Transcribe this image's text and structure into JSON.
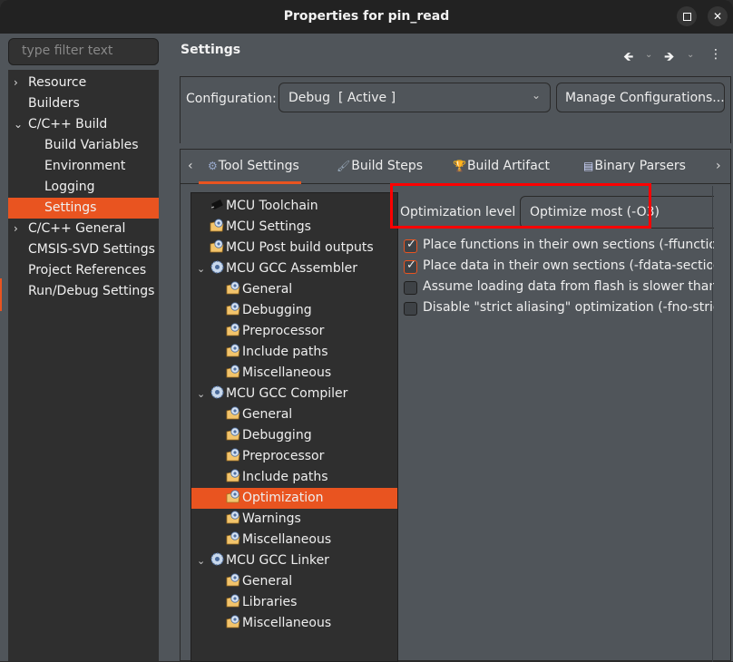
{
  "window": {
    "title": "Properties for pin_read",
    "maximize_icon": "maximize-icon",
    "close_icon": "close-icon"
  },
  "left": {
    "filter_placeholder": "type filter text",
    "nav": [
      {
        "label": "Resource",
        "expander": "collapsed",
        "level": 0
      },
      {
        "label": "Builders",
        "expander": "none",
        "level": 0
      },
      {
        "label": "C/C++ Build",
        "expander": "expanded",
        "level": 0
      },
      {
        "label": "Build Variables",
        "expander": "none",
        "level": 1
      },
      {
        "label": "Environment",
        "expander": "none",
        "level": 1
      },
      {
        "label": "Logging",
        "expander": "none",
        "level": 1
      },
      {
        "label": "Settings",
        "expander": "none",
        "level": 1,
        "selected": true
      },
      {
        "label": "C/C++ General",
        "expander": "collapsed",
        "level": 0
      },
      {
        "label": "CMSIS-SVD Settings",
        "expander": "none",
        "level": 0
      },
      {
        "label": "Project References",
        "expander": "none",
        "level": 0
      },
      {
        "label": "Run/Debug Settings",
        "expander": "none",
        "level": 0
      }
    ]
  },
  "main": {
    "heading": "Settings",
    "nav_icons": [
      "back-arrow-icon",
      "back-history-icon",
      "forward-arrow-icon",
      "forward-history-icon",
      "view-menu-icon"
    ],
    "configuration": {
      "label": "Configuration:",
      "value": "Debug  [ Active ]",
      "manage_button": "Manage Configurations..."
    },
    "tabs": [
      {
        "label": "Tool Settings",
        "icon": "tool-settings-icon",
        "active": true
      },
      {
        "label": "Build Steps",
        "icon": "build-steps-icon"
      },
      {
        "label": "Build Artifact",
        "icon": "build-artifact-icon"
      },
      {
        "label": "Binary Parsers",
        "icon": "binary-parsers-icon"
      }
    ],
    "tool_tree": [
      {
        "label": "MCU Toolchain",
        "icon": "chip",
        "level": 0,
        "expander": "none"
      },
      {
        "label": "MCU Settings",
        "icon": "folder",
        "level": 0,
        "expander": "none"
      },
      {
        "label": "MCU Post build outputs",
        "icon": "folder",
        "level": 0,
        "expander": "none"
      },
      {
        "label": "MCU GCC Assembler",
        "icon": "gear",
        "level": 0,
        "expander": "expanded"
      },
      {
        "label": "General",
        "icon": "folder",
        "level": 1
      },
      {
        "label": "Debugging",
        "icon": "folder",
        "level": 1
      },
      {
        "label": "Preprocessor",
        "icon": "folder",
        "level": 1
      },
      {
        "label": "Include paths",
        "icon": "folder",
        "level": 1
      },
      {
        "label": "Miscellaneous",
        "icon": "folder",
        "level": 1
      },
      {
        "label": "MCU GCC Compiler",
        "icon": "gear",
        "level": 0,
        "expander": "expanded"
      },
      {
        "label": "General",
        "icon": "folder",
        "level": 1
      },
      {
        "label": "Debugging",
        "icon": "folder",
        "level": 1
      },
      {
        "label": "Preprocessor",
        "icon": "folder",
        "level": 1
      },
      {
        "label": "Include paths",
        "icon": "folder",
        "level": 1
      },
      {
        "label": "Optimization",
        "icon": "folder",
        "level": 1,
        "selected": true
      },
      {
        "label": "Warnings",
        "icon": "folder",
        "level": 1
      },
      {
        "label": "Miscellaneous",
        "icon": "folder",
        "level": 1
      },
      {
        "label": "MCU GCC Linker",
        "icon": "gear",
        "level": 0,
        "expander": "expanded"
      },
      {
        "label": "General",
        "icon": "folder",
        "level": 1
      },
      {
        "label": "Libraries",
        "icon": "folder",
        "level": 1
      },
      {
        "label": "Miscellaneous",
        "icon": "folder",
        "level": 1
      }
    ],
    "optimization": {
      "label": "Optimization level",
      "value": "Optimize most (-O3)",
      "options": [
        {
          "label": "Place functions in their own sections (-ffunction-sections)",
          "checked": true
        },
        {
          "label": "Place data in their own sections (-fdata-sections)",
          "checked": true
        },
        {
          "label": "Assume loading data from flash is slower than fetching instructions",
          "checked": false
        },
        {
          "label": "Disable \"strict aliasing\" optimization (-fno-strict-aliasing)",
          "checked": false
        }
      ]
    }
  },
  "colors": {
    "accent": "#e95420",
    "highlight_box": "#ff0000",
    "panel_bg": "#50555a",
    "tree_bg": "#2f2f2f"
  }
}
